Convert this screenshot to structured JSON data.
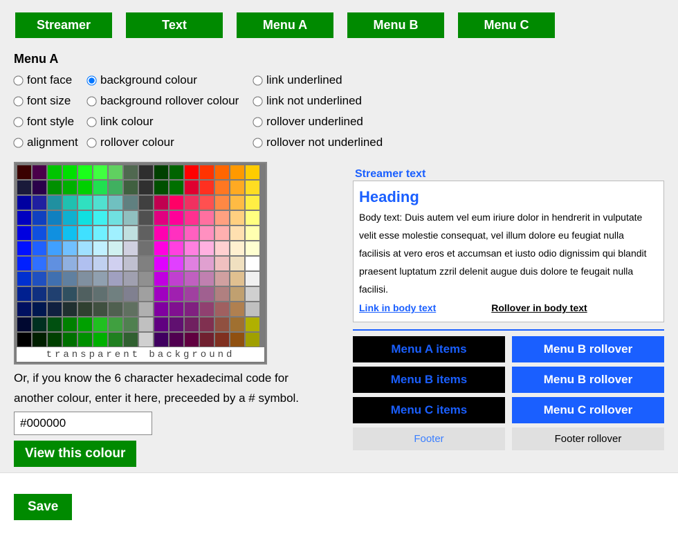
{
  "tabs": [
    "Streamer",
    "Text",
    "Menu A",
    "Menu B",
    "Menu C"
  ],
  "section_title": "Menu A",
  "radio_options": [
    [
      "font face",
      "background colour",
      "link underlined"
    ],
    [
      "font size",
      "background rollover colour",
      "link not underlined"
    ],
    [
      "font style",
      "link colour",
      "rollover underlined"
    ],
    [
      "alignment",
      "rollover colour",
      "rollover not underlined"
    ]
  ],
  "radio_selected": "background colour",
  "palette_rows": [
    [
      "#3a0000",
      "#4a004a",
      "#00c400",
      "#00e000",
      "#1aff1a",
      "#40ff40",
      "#60d060",
      "#506850",
      "#2e2e2e",
      "#004000",
      "#006400",
      "#ff0000",
      "#ff3300",
      "#ff6600",
      "#ff9900",
      "#ffcc00"
    ],
    [
      "#1a1a3a",
      "#2a004a",
      "#009000",
      "#00b000",
      "#00d000",
      "#20e050",
      "#40b060",
      "#406040",
      "#303030",
      "#005000",
      "#007000",
      "#e00030",
      "#ff3020",
      "#ff7722",
      "#ffaa22",
      "#ffdd22"
    ],
    [
      "#0000a0",
      "#2020a0",
      "#2090a0",
      "#20c0b0",
      "#30e0c0",
      "#50e0d0",
      "#70c0c0",
      "#608080",
      "#404040",
      "#c00050",
      "#ff0066",
      "#f03060",
      "#ff5050",
      "#ff8844",
      "#ffbb44",
      "#ffee44"
    ],
    [
      "#0000c0",
      "#1040c0",
      "#1080c0",
      "#10b0d0",
      "#10e0e0",
      "#40f0f0",
      "#70e0e0",
      "#90c0c0",
      "#505050",
      "#e00080",
      "#ff0099",
      "#ff3090",
      "#ff70a0",
      "#ffa080",
      "#ffd080",
      "#ffff80"
    ],
    [
      "#0000e0",
      "#1050e0",
      "#1090e0",
      "#10c0f0",
      "#40e0ff",
      "#70f0ff",
      "#a0f0ff",
      "#c0e0e0",
      "#606060",
      "#ff00b0",
      "#ff30c0",
      "#ff60c0",
      "#ff90c0",
      "#ffb0b0",
      "#ffe0b0",
      "#ffffb0"
    ],
    [
      "#0010ff",
      "#2060ff",
      "#40a0ff",
      "#70c0ff",
      "#a0e0ff",
      "#c0f0ff",
      "#d0f0f0",
      "#d0d0e0",
      "#707070",
      "#ff00e0",
      "#ff40e0",
      "#ff80e0",
      "#ffb0e0",
      "#ffd0d0",
      "#fff0d0",
      "#ffffd0"
    ],
    [
      "#0020ff",
      "#3070ff",
      "#6090e0",
      "#90b0e0",
      "#b0c0f0",
      "#c0d0f0",
      "#d0d0f0",
      "#c0c0d0",
      "#808080",
      "#e000ff",
      "#e040ff",
      "#e080e0",
      "#e0a0d0",
      "#f0c0c0",
      "#f0e0c0",
      "#ffffff"
    ],
    [
      "#0030d0",
      "#2050c0",
      "#4070b0",
      "#6080a0",
      "#8090a0",
      "#90a0b0",
      "#a0a0c0",
      "#a0a0b0",
      "#909090",
      "#c000e0",
      "#c040d0",
      "#c060c0",
      "#c080b0",
      "#d0a0a0",
      "#e0c090",
      "#f0f0f0"
    ],
    [
      "#002090",
      "#103080",
      "#204070",
      "#305060",
      "#506060",
      "#607070",
      "#708080",
      "#808090",
      "#a0a0a0",
      "#a000c0",
      "#a020b0",
      "#a040a0",
      "#a06090",
      "#b08080",
      "#c0a070",
      "#d0d0d0"
    ],
    [
      "#001060",
      "#001850",
      "#102040",
      "#203030",
      "#304030",
      "#405040",
      "#506050",
      "#607060",
      "#b0b0b0",
      "#8000a0",
      "#801090",
      "#802080",
      "#904070",
      "#a06060",
      "#b08050",
      "#c0c0c0"
    ],
    [
      "#000830",
      "#003020",
      "#005010",
      "#008000",
      "#00a000",
      "#20c020",
      "#40a040",
      "#508050",
      "#c0c0c0",
      "#600080",
      "#601070",
      "#702060",
      "#803050",
      "#905040",
      "#a07030",
      "#b0b000"
    ],
    [
      "#000000",
      "#002000",
      "#004000",
      "#007000",
      "#009000",
      "#00b000",
      "#208020",
      "#306030",
      "#d0d0d0",
      "#400060",
      "#500050",
      "#600040",
      "#702030",
      "#803020",
      "#905010",
      "#a0a000"
    ]
  ],
  "transparent_label": "transparent background",
  "hint_text": "Or, if you know the 6 character hexadecimal code for another colour, enter it here, preceeded by a # symbol.",
  "hex_value": "#000000",
  "view_label": "View this colour",
  "preview": {
    "streamer": "Streamer text",
    "heading": "Heading",
    "body": "Body text: Duis autem vel eum iriure dolor in hendrerit in vulputate velit esse molestie consequat, vel illum dolore eu feugiat nulla facilisis at vero eros et accumsan et iusto odio dignissim qui blandit praesent luptatum zzril delenit augue duis dolore te feugait nulla facilisi.",
    "link": "Link in body text",
    "rollover": "Rollover in body text"
  },
  "menu_rows": [
    {
      "left": "Menu A items",
      "left_style": "menu-black",
      "right": "Menu B rollover",
      "right_style": "menu-blue"
    },
    {
      "left": "Menu B items",
      "left_style": "menu-black",
      "right": "Menu B rollover",
      "right_style": "menu-blue"
    },
    {
      "left": "Menu C items",
      "left_style": "menu-black",
      "right": "Menu C rollover",
      "right_style": "menu-blue"
    },
    {
      "left": "Footer",
      "left_style": "menu-grey",
      "right": "Footer rollover",
      "right_style": "menu-grey2"
    }
  ],
  "save_label": "Save"
}
